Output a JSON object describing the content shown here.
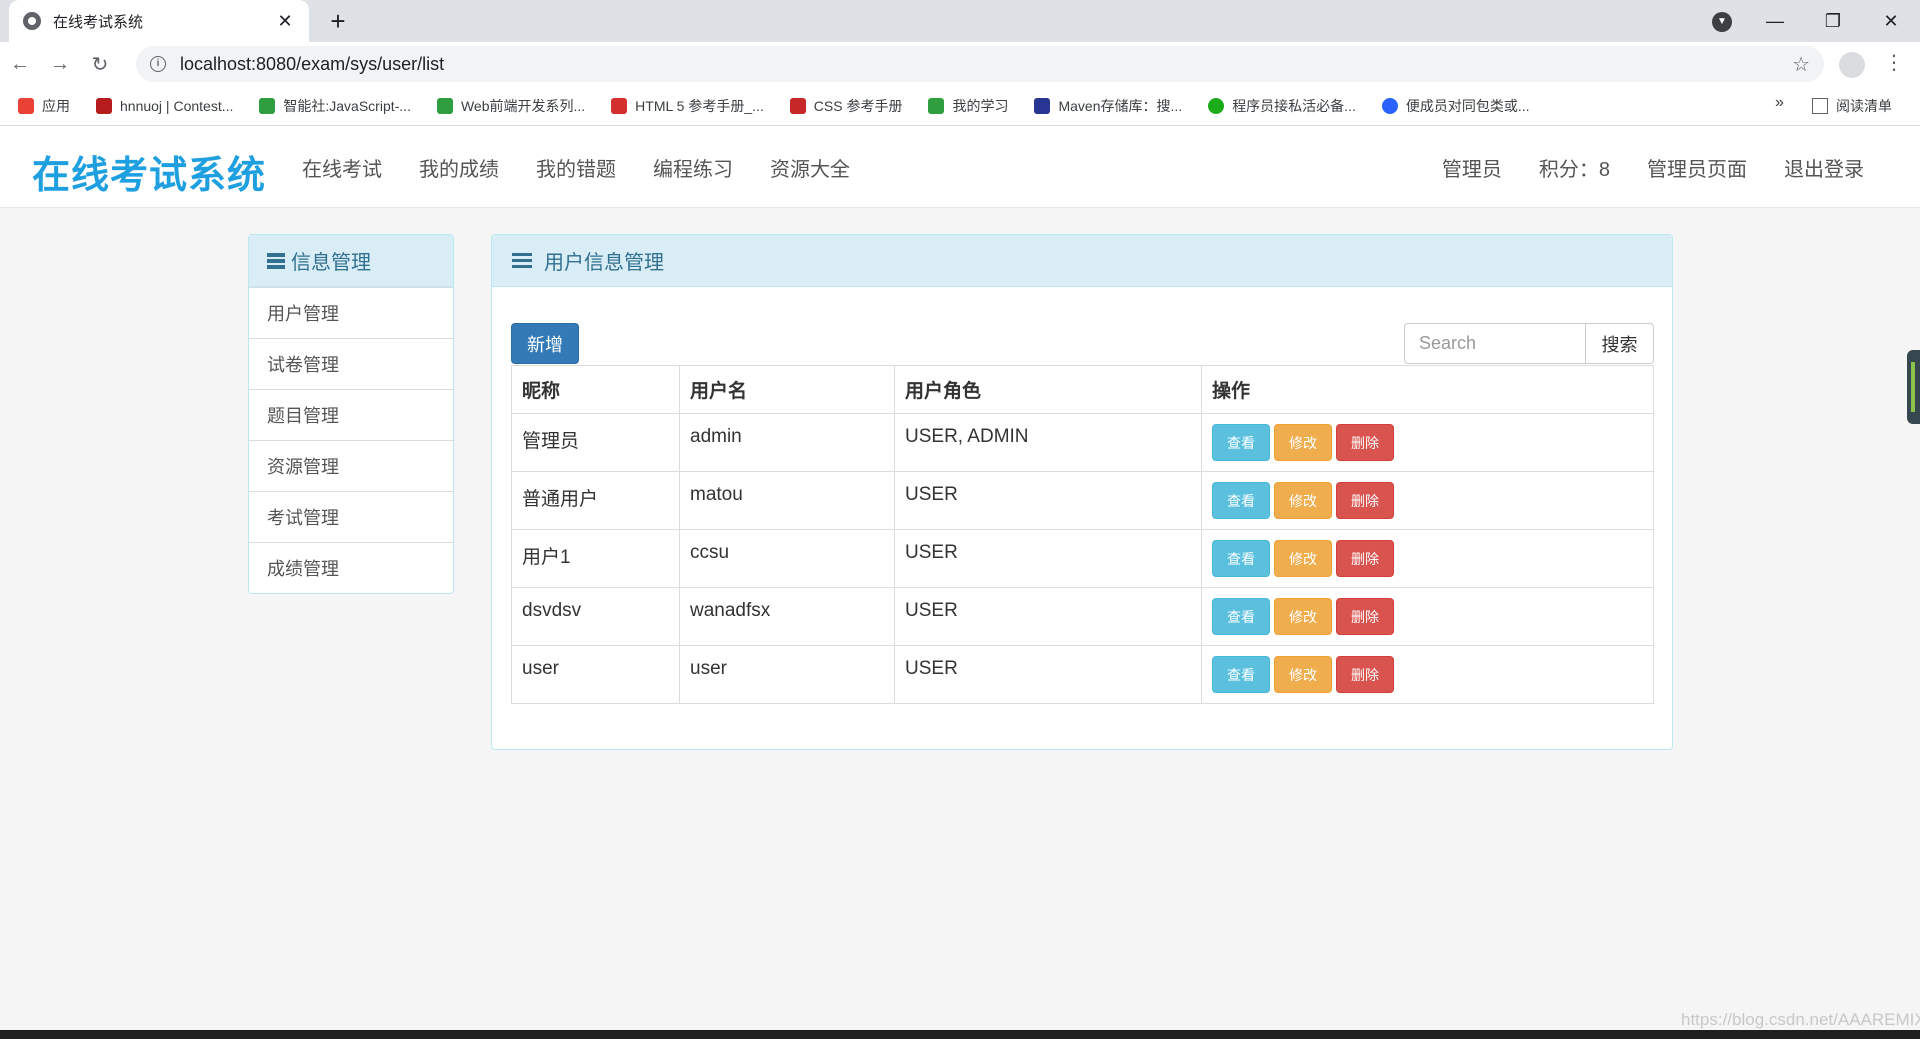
{
  "browser": {
    "tab_title": "在线考试系统",
    "tab_close": "✕",
    "new_tab": "+",
    "url": "localhost:8080/exam/sys/user/list",
    "back": "←",
    "forward": "→",
    "reload": "↻",
    "star": "☆",
    "menu": "⋮",
    "window_controls": {
      "minimize": "—",
      "restore": "❐",
      "close": "✕"
    },
    "bookmarks": [
      {
        "label": "应用",
        "color": "#e94235"
      },
      {
        "label": "hnnuoj | Contest...",
        "color": "#b71c1c"
      },
      {
        "label": "智能社:JavaScript-...",
        "color": "#2e9e3e"
      },
      {
        "label": "Web前端开发系列...",
        "color": "#2e9e3e"
      },
      {
        "label": "HTML 5 参考手册_...",
        "color": "#d32f2f"
      },
      {
        "label": "CSS 参考手册",
        "color": "#c62828"
      },
      {
        "label": "我的学习",
        "color": "#2e9e3e"
      },
      {
        "label": "Maven存储库：搜...",
        "color": "#283593"
      },
      {
        "label": "程序员接私活必备...",
        "color": "#1aad19"
      },
      {
        "label": "便成员对同包类或...",
        "color": "#2962ff"
      }
    ],
    "bookmarks_more": "»",
    "reading_list": "阅读清单"
  },
  "app": {
    "brand": "在线考试系统",
    "nav": [
      "在线考试",
      "我的成绩",
      "我的错题",
      "编程练习",
      "资源大全"
    ],
    "nav_right": {
      "role": "管理员",
      "points": "积分：8",
      "admin_page": "管理员页面",
      "logout": "退出登录"
    }
  },
  "sidebar": {
    "title": "信息管理",
    "items": [
      "用户管理",
      "试卷管理",
      "题目管理",
      "资源管理",
      "考试管理",
      "成绩管理"
    ]
  },
  "main": {
    "title": "用户信息管理",
    "add_label": "新增",
    "search_placeholder": "Search",
    "search_label": "搜索",
    "columns": [
      "昵称",
      "用户名",
      "用户角色",
      "操作"
    ],
    "rows": [
      {
        "nickname": "管理员",
        "username": "admin",
        "roles": "USER, ADMIN"
      },
      {
        "nickname": "普通用户",
        "username": "matou",
        "roles": "USER"
      },
      {
        "nickname": "用户1",
        "username": "ccsu",
        "roles": "USER"
      },
      {
        "nickname": "dsvdsv",
        "username": "wanadfsx",
        "roles": "USER"
      },
      {
        "nickname": "user",
        "username": "user",
        "roles": "USER"
      }
    ],
    "actions": {
      "view": "查看",
      "edit": "修改",
      "delete": "删除"
    }
  },
  "watermark": "https://blog.csdn.net/AAAREMIX"
}
